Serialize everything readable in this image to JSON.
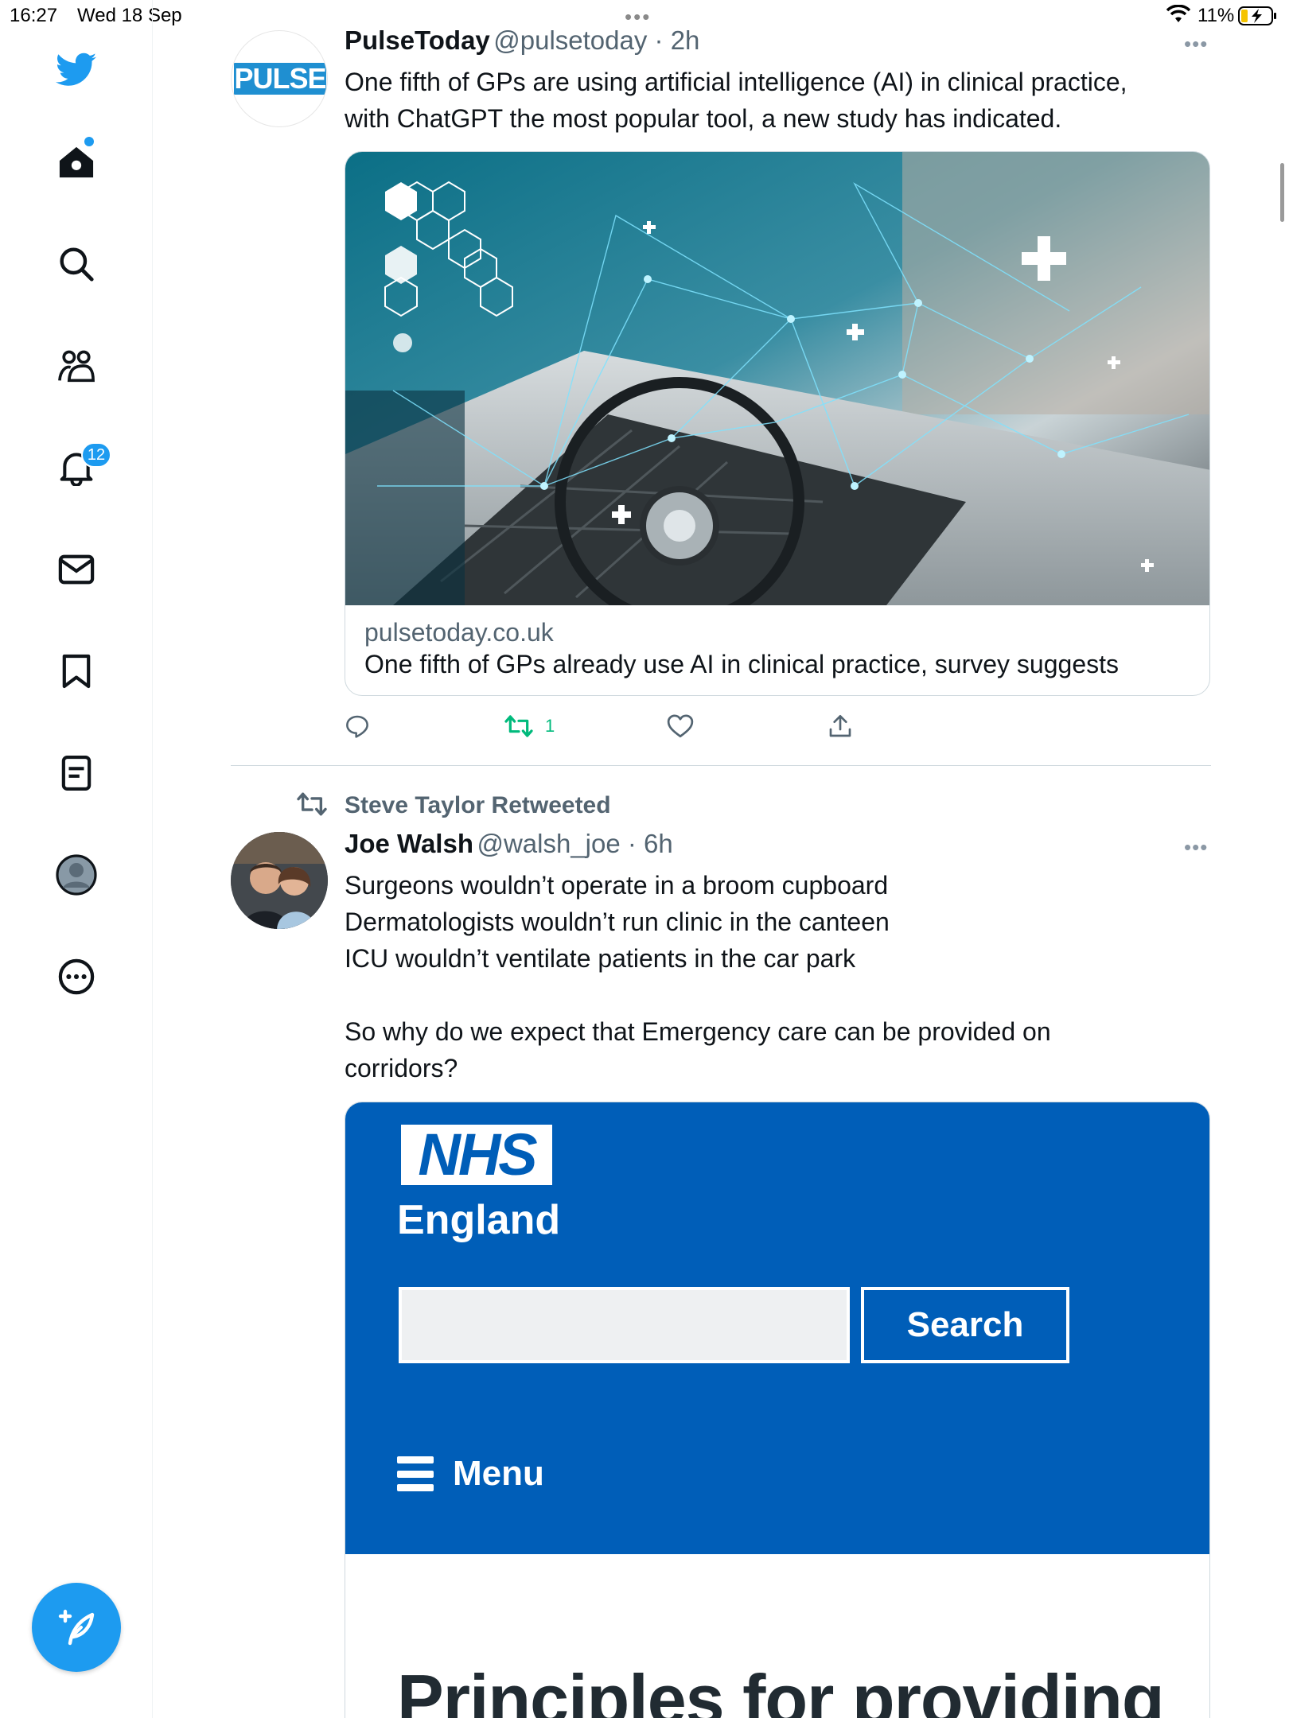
{
  "status_bar": {
    "time": "16:27",
    "date": "Wed 18 Sep",
    "battery_percent": "11%"
  },
  "sidebar": {
    "notifications_count": "12",
    "accent": "#1d9bf0"
  },
  "tweets": [
    {
      "author_name": "PulseToday",
      "handle": "@pulsetoday",
      "time": "2h",
      "avatar_text": "PULSE",
      "text_lines": [
        "One fifth of GPs are using artificial intelligence (AI) in clinical practice,",
        "with ChatGPT the most popular tool, a new study has indicated."
      ],
      "card": {
        "domain": "pulsetoday.co.uk",
        "title": "One fifth of GPs already use AI in clinical practice, survey suggests"
      },
      "retweet_count": "1",
      "retweet_color": "#00ba7c"
    },
    {
      "retweeted_by": "Steve Taylor Retweeted",
      "author_name": "Joe Walsh",
      "handle": "@walsh_joe",
      "time": "6h",
      "text_lines": [
        "Surgeons wouldn’t operate in a broom cupboard",
        "Dermatologists wouldn’t run clinic in the canteen",
        "ICU wouldn’t ventilate patients in the car park",
        "",
        "So why do we expect that Emergency care can be provided on",
        "corridors?"
      ],
      "embed": {
        "logo": "NHS",
        "region": "England",
        "search_button": "Search",
        "menu": "Menu",
        "heading": "Principles for providing",
        "brand_color": "#005eb8"
      }
    }
  ]
}
